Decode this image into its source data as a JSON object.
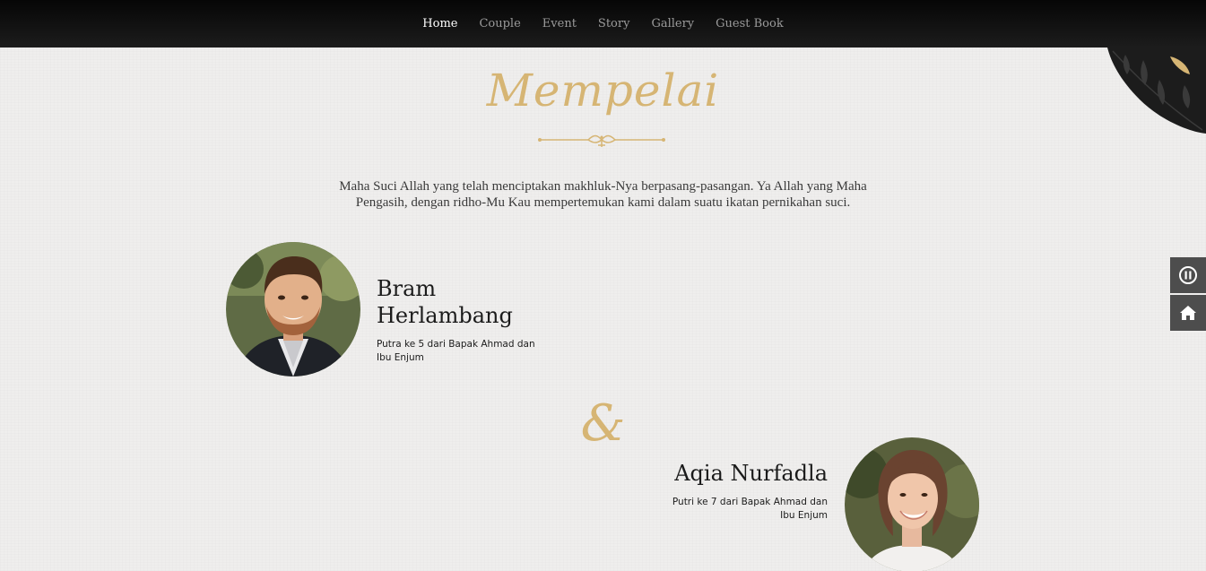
{
  "nav": {
    "items": [
      {
        "label": "Home",
        "active": true
      },
      {
        "label": "Couple",
        "active": false
      },
      {
        "label": "Event",
        "active": false
      },
      {
        "label": "Story",
        "active": false
      },
      {
        "label": "Gallery",
        "active": false
      },
      {
        "label": "Guest Book",
        "active": false
      }
    ]
  },
  "section": {
    "title": "Mempelai",
    "intro": "Maha Suci Allah yang telah menciptakan makhluk-Nya berpasang-pasangan. Ya Allah yang Maha Pengasih, dengan ridho-Mu Kau mempertemukan kami dalam suatu ikatan pernikahan suci."
  },
  "groom": {
    "name": "Bram Herlambang",
    "parents": "Putra ke 5 dari Bapak Ahmad dan Ibu Enjum"
  },
  "separator": "&",
  "bride": {
    "name": "Aqia Nurfadla",
    "parents": "Putri ke 7 dari Bapak Ahmad dan Ibu Enjum"
  },
  "controls": {
    "music_icon": "pause-icon",
    "home_icon": "home-icon"
  },
  "colors": {
    "accent_gold": "#d6b574",
    "nav_bg": "#0a0a0a",
    "side_button_bg": "#4d4d4d"
  }
}
